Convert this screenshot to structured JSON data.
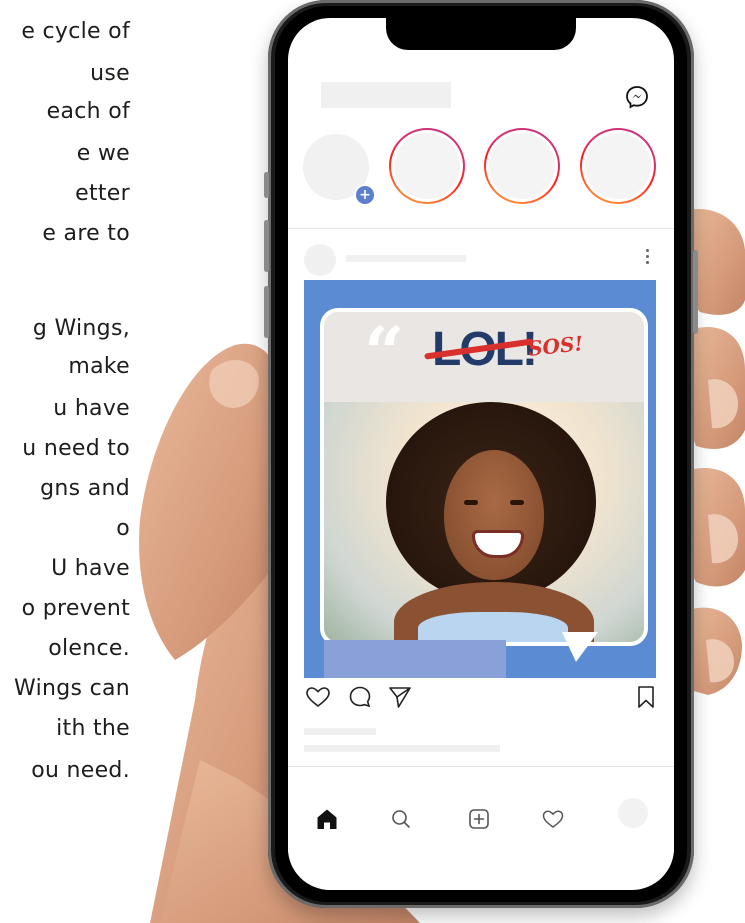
{
  "copy": {
    "lines": [
      "e cycle of",
      "use",
      "each of",
      "e we",
      "etter",
      "e are to",
      "g Wings,",
      "make",
      "u have",
      "u need to",
      "gns and",
      "o",
      "U have",
      "o prevent",
      "olence.",
      "Wings can",
      "ith the",
      "ou need."
    ]
  },
  "app": {
    "header_icon": "messenger-icon"
  },
  "post": {
    "graphic_text_main": "LOL!",
    "graphic_text_accent": "SOS!",
    "graphic_quote": "“"
  },
  "icons": {
    "like": "heart-icon",
    "comment": "comment-icon",
    "share": "send-icon",
    "save": "bookmark-icon",
    "home": "home-icon",
    "search": "search-icon",
    "new_post": "add-post-icon",
    "activity": "heart-icon",
    "profile": "profile-icon"
  },
  "colors": {
    "post_background": "#5b8bd2",
    "lol_text": "#233b69",
    "accent_red": "#d8302c",
    "add_badge": "#5b7fcc"
  }
}
